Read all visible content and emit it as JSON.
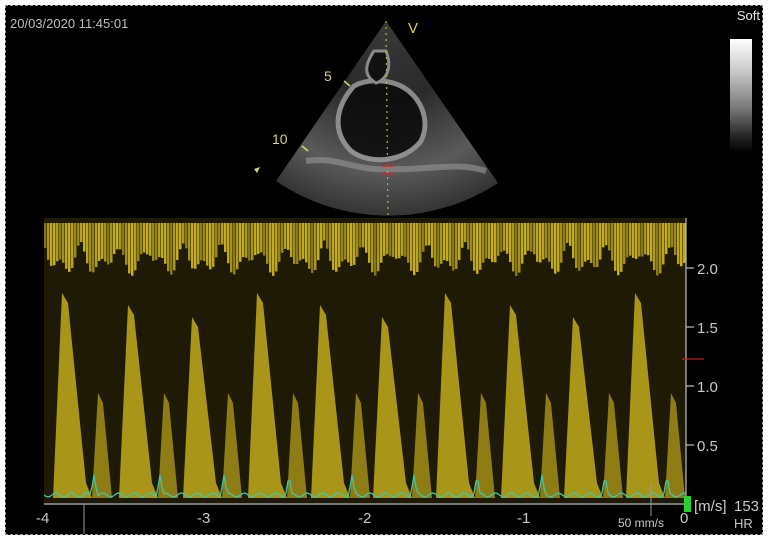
{
  "header": {
    "timestamp": "20/03/2020 11:45:01",
    "preset": "Soft",
    "probe_marker": "V"
  },
  "depth_scale": {
    "labels": [
      "5",
      "10"
    ]
  },
  "doppler": {
    "y_axis": {
      "ticks": [
        "0.5",
        "1.0",
        "1.5",
        "2.0"
      ],
      "unit": "[m/s]"
    },
    "x_axis": {
      "ticks": [
        "-4",
        "-3",
        "-2",
        "-1",
        "0"
      ]
    },
    "sweep_speed": "50 mm/s",
    "heart_rate": {
      "value": "153",
      "label": "HR"
    }
  },
  "colors": {
    "spectrum": "#d8c020",
    "ecg": "#3cc8a8",
    "axis_marker": "#c02020",
    "probe_marker": "#d4d24a"
  }
}
